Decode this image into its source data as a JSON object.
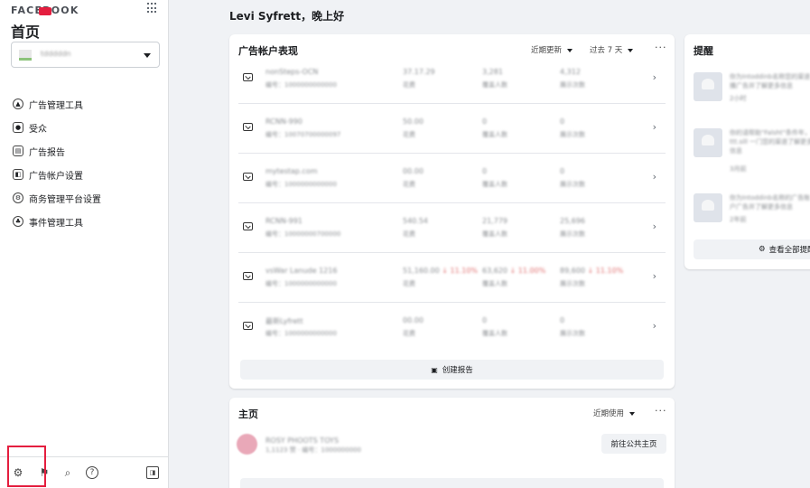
{
  "sidebar": {
    "brand": "FACEBOOK",
    "home_title": "首页",
    "account_selector": {
      "value": "tdddddn"
    },
    "nav": [
      {
        "label": "广告管理工具",
        "icon": "ads-manager-icon",
        "glyph": "▲"
      },
      {
        "label": "受众",
        "icon": "audience-icon",
        "glyph": "●"
      },
      {
        "label": "广告报告",
        "icon": "ad-report-icon",
        "glyph": "▤"
      },
      {
        "label": "广告帐户设置",
        "icon": "ad-account-settings-icon",
        "glyph": "◧"
      },
      {
        "label": "商务管理平台设置",
        "icon": "business-settings-icon",
        "glyph": "⚙"
      },
      {
        "label": "事件管理工具",
        "icon": "events-manager-icon",
        "glyph": "♣"
      }
    ],
    "bottom_icons": [
      "gear-icon",
      "flag-icon",
      "search-icon",
      "help-icon",
      "panel-toggle-icon"
    ]
  },
  "greeting": "Levi Syfrett，晚上好",
  "ad_performance": {
    "title": "广告帐户表现",
    "sort_label": "近期更新",
    "range_label": "过去 7 天",
    "more": "···",
    "rows": [
      {
        "name": "nonSteps-OCN",
        "sub": "编号：1000000000000",
        "c1": "37.17.29",
        "c1s": "花费",
        "c2": "3,281",
        "c2s": "覆盖人数",
        "c3": "4,312",
        "c3s": "展示次数"
      },
      {
        "name": "RCNN-990",
        "sub": "编号：10070700000097",
        "c1": "50.00",
        "c1s": "花费",
        "c2": "0",
        "c2s": "覆盖人数",
        "c3": "0",
        "c3s": "展示次数"
      },
      {
        "name": "mytestap.com",
        "sub": "编号：1000000000000",
        "c1": "00.00",
        "c1s": "花费",
        "c2": "0",
        "c2s": "覆盖人数",
        "c3": "0",
        "c3s": "展示次数"
      },
      {
        "name": "RCNN-991",
        "sub": "编号：10000000700000",
        "c1": "540.54",
        "c1s": "花费",
        "c2": "21,779",
        "c2s": "覆盖人数",
        "c3": "25,696",
        "c3s": "展示次数"
      },
      {
        "name": "vsWar Lanude 1216",
        "sub": "编号：1000000000000",
        "c1": "51,160.00",
        "c1s": "花费",
        "c1r": "↓ 11.10%",
        "c2": "63,620",
        "c2s": "覆盖人数",
        "c2r": "↓ 11.00%",
        "c3": "89,600",
        "c3s": "展示次数",
        "c3r": "↓ 11.10%"
      },
      {
        "name": "最新Lyfrett",
        "sub": "编号：1000000000000",
        "c1": "00.00",
        "c1s": "花费",
        "c2": "0",
        "c2s": "覆盖人数",
        "c3": "0",
        "c3s": "展示次数"
      }
    ],
    "create_report": "创建报告"
  },
  "homepage": {
    "title": "主页",
    "filter_label": "近期使用",
    "more": "···",
    "page_name": "ROSY PHOOTS TOYS",
    "page_sub": "1,1123 赞 · 编号：1000000000",
    "goto_button": "前往公共主页"
  },
  "reminders": {
    "title": "提醒",
    "items": [
      {
        "text": "你为Intoddinb名称您的渠道播广告并了解更多信息",
        "time": "2小时"
      },
      {
        "text": "你的请帮助\"Falsht\"条件年，1 ttt.sill 一门您的渠道了解更多信息",
        "time": "3月前"
      },
      {
        "text": "你为Intoddinb名称的广告账户广告并了解更多信息",
        "time": "2年前"
      }
    ],
    "view_all": "查看全部提醒"
  }
}
